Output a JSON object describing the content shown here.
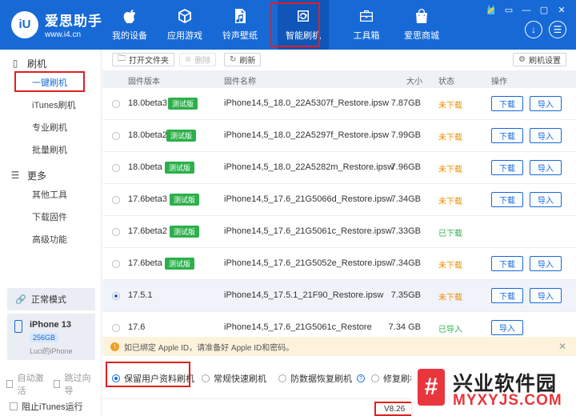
{
  "app": {
    "logo_mark": "iU",
    "name": "爱思助手",
    "url": "www.i4.cn"
  },
  "nav": [
    {
      "label": "我的设备",
      "icon": "apple-icon"
    },
    {
      "label": "应用游戏",
      "icon": "cube-icon"
    },
    {
      "label": "铃声壁纸",
      "icon": "music-file-icon"
    },
    {
      "label": "智能刷机",
      "icon": "refresh-box-icon",
      "active": true
    },
    {
      "label": "工具箱",
      "icon": "toolbox-icon"
    },
    {
      "label": "爱思商城",
      "icon": "shopping-bag-icon"
    }
  ],
  "window_controls": [
    "🎽",
    "▭",
    "—",
    "▢",
    "✕"
  ],
  "round_buttons": [
    "↓",
    "☰"
  ],
  "sidebar": {
    "flash_section": "刷机",
    "flash_items": [
      "一键刷机",
      "iTunes刷机",
      "专业刷机",
      "批量刷机"
    ],
    "more_section": "更多",
    "more_items": [
      "其他工具",
      "下载固件",
      "高级功能"
    ],
    "device_mode": "正常模式",
    "device_name": "iPhone 13",
    "device_storage": "256GB",
    "device_owner": "Luci的iPhone",
    "auto_activate": "自动激活",
    "skip_guide": "跳过向导"
  },
  "toolbar": {
    "open_folder": "打开文件夹",
    "delete": "删除",
    "refresh": "刷新",
    "settings": "刷机设置"
  },
  "table": {
    "headers": {
      "version": "固件版本",
      "name": "固件名称",
      "size": "大小",
      "status": "状态",
      "action": "操作"
    },
    "rows": [
      {
        "version": "18.0beta3",
        "tag": "测试版",
        "name": "iPhone14,5_18.0_22A5307f_Restore.ipsw",
        "size": "7.87GB",
        "status": "未下载",
        "status_type": "pending",
        "actions": [
          "下载",
          "导入"
        ],
        "selected": false
      },
      {
        "version": "18.0beta2",
        "tag": "测试版",
        "name": "iPhone14,5_18.0_22A5297f_Restore.ipsw",
        "size": "7.99GB",
        "status": "未下载",
        "status_type": "pending",
        "actions": [
          "下载",
          "导入"
        ],
        "selected": false
      },
      {
        "version": "18.0beta",
        "tag": "测试版",
        "name": "iPhone14,5_18.0_22A5282m_Restore.ipsw",
        "size": "7.96GB",
        "status": "未下载",
        "status_type": "pending",
        "actions": [
          "下载",
          "导入"
        ],
        "selected": false
      },
      {
        "version": "17.6beta3",
        "tag": "测试版",
        "name": "iPhone14,5_17.6_21G5066d_Restore.ipsw",
        "size": "7.34GB",
        "status": "未下载",
        "status_type": "pending",
        "actions": [
          "下载",
          "导入"
        ],
        "selected": false
      },
      {
        "version": "17.6beta2",
        "tag": "测试版",
        "name": "iPhone14,5_17.6_21G5061c_Restore.ipsw",
        "size": "7.33GB",
        "status": "已下载",
        "status_type": "done",
        "actions": [],
        "selected": false
      },
      {
        "version": "17.6beta",
        "tag": "测试版",
        "name": "iPhone14,5_17.6_21G5052e_Restore.ipsw",
        "size": "7.34GB",
        "status": "未下载",
        "status_type": "pending",
        "actions": [
          "下载",
          "导入"
        ],
        "selected": false
      },
      {
        "version": "17.5.1",
        "tag": "",
        "name": "iPhone14,5_17.5.1_21F90_Restore.ipsw",
        "size": "7.35GB",
        "status": "未下载",
        "status_type": "pending",
        "actions": [
          "下载",
          "导入"
        ],
        "selected": true
      },
      {
        "version": "17.6",
        "tag": "",
        "name": "iPhone14,5_17.6_21G5061c_Restore",
        "size": "7.34 GB",
        "status": "已导入",
        "status_type": "done",
        "actions": [
          "导入"
        ],
        "selected": false
      }
    ]
  },
  "notice": "如已绑定 Apple ID，请准备好 Apple ID和密码。",
  "options": {
    "keep_data": "保留用户资料刷机",
    "quick_flash": "常规快速刷机",
    "anti_recovery": "防数据恢复刷机",
    "repair_flash": "修复刷机"
  },
  "footer": {
    "block_itunes": "阻止iTunes运行",
    "version": "V8.26"
  },
  "watermark": {
    "logo": "#",
    "cn": "兴业软件园",
    "en": "MYXYJS.COM"
  }
}
